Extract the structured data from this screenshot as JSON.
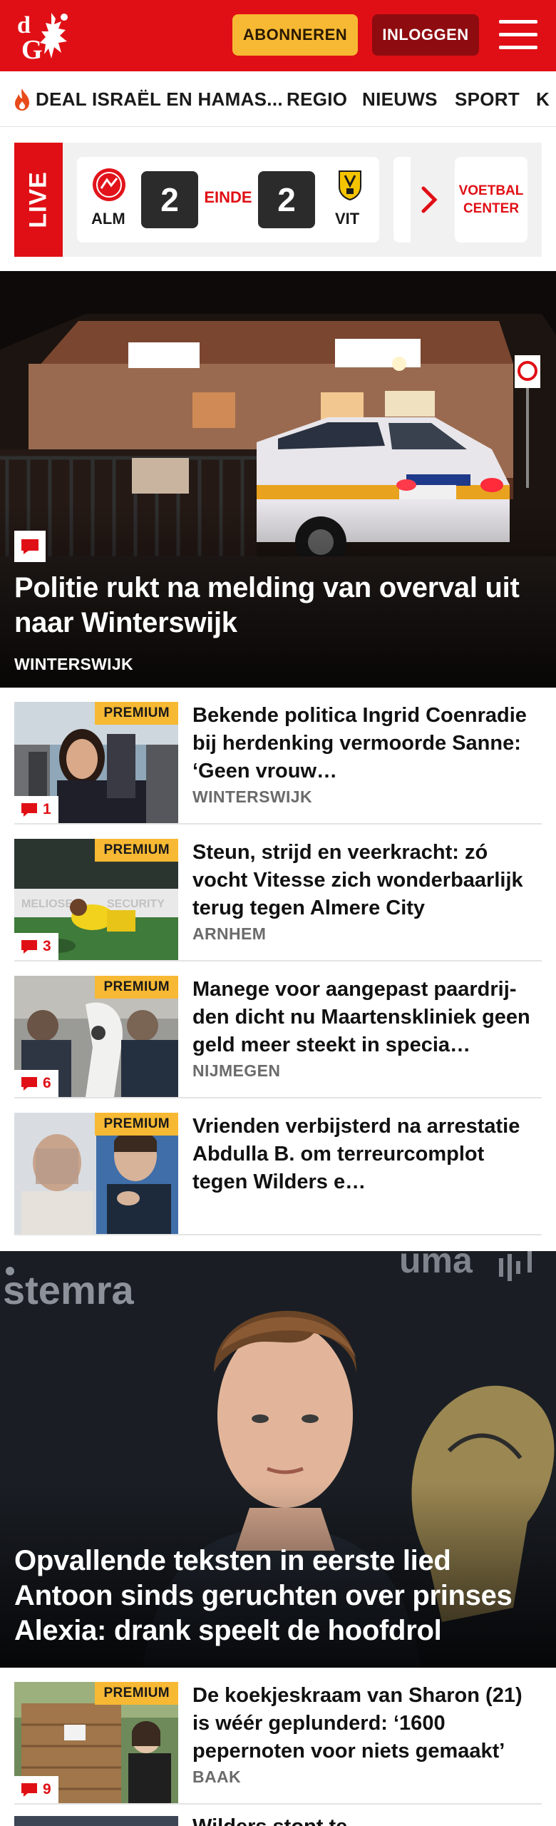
{
  "header": {
    "subscribe_label": "ABONNEREN",
    "login_label": "INLOGGEN",
    "brand_color": "#e00f15"
  },
  "nav": {
    "items": [
      {
        "label": "DEAL ISRAËL EN HAMAS...",
        "icon": "flame-icon"
      },
      {
        "label": "REGIO"
      },
      {
        "label": "NIEUWS"
      },
      {
        "label": "SPORT"
      },
      {
        "label": "K"
      }
    ]
  },
  "live": {
    "label": "LIVE",
    "match": {
      "home_code": "ALM",
      "away_code": "VIT",
      "home_score": "2",
      "away_score": "2",
      "status": "EINDE"
    },
    "voetbal_center_line1": "VOETBAL",
    "voetbal_center_line2": "CENTER"
  },
  "hero1": {
    "title": "Politie rukt na melding van overval uit naar Winterswijk",
    "location": "WINTERSWIJK"
  },
  "articles": [
    {
      "title": "Bekende politica Ingrid Coenradie bij herdenking vermoorde Sanne: ‘Geen vrouw…",
      "location": "WINTERSWIJK",
      "badge": "PREMIUM",
      "comments": "1"
    },
    {
      "title": "Steun, strijd en veerkracht: zó vocht Vitesse zich wonderbaar­lijk terug tegen Almere City",
      "location": "ARNHEM",
      "badge": "PREMIUM",
      "comments": "3"
    },
    {
      "title": "Manege voor aangepast paardrij­den dicht nu Maartenskliniek geen geld meer steekt in specia…",
      "location": "NIJMEGEN",
      "badge": "PREMIUM",
      "comments": "6"
    },
    {
      "title": "Vrienden verbijsterd na arrestatie Abdulla B. om terreurcomplot tegen Wilders e…",
      "location": "",
      "badge": "PREMIUM",
      "comments": ""
    }
  ],
  "hero2": {
    "title": "Opvallende teksten in eerste lied Antoon sinds geruchten over prinses Alexia: drank speelt de hoofdrol"
  },
  "articles2": [
    {
      "title": "De koekjeskraam van Sharon (21) is wéér geplunderd: ‘1600 pepernoten voor niets gemaakt’",
      "location": "BAAK",
      "badge": "PREMIUM",
      "comments": "9"
    }
  ],
  "peek": {
    "title": "Wilders stopt te…"
  }
}
